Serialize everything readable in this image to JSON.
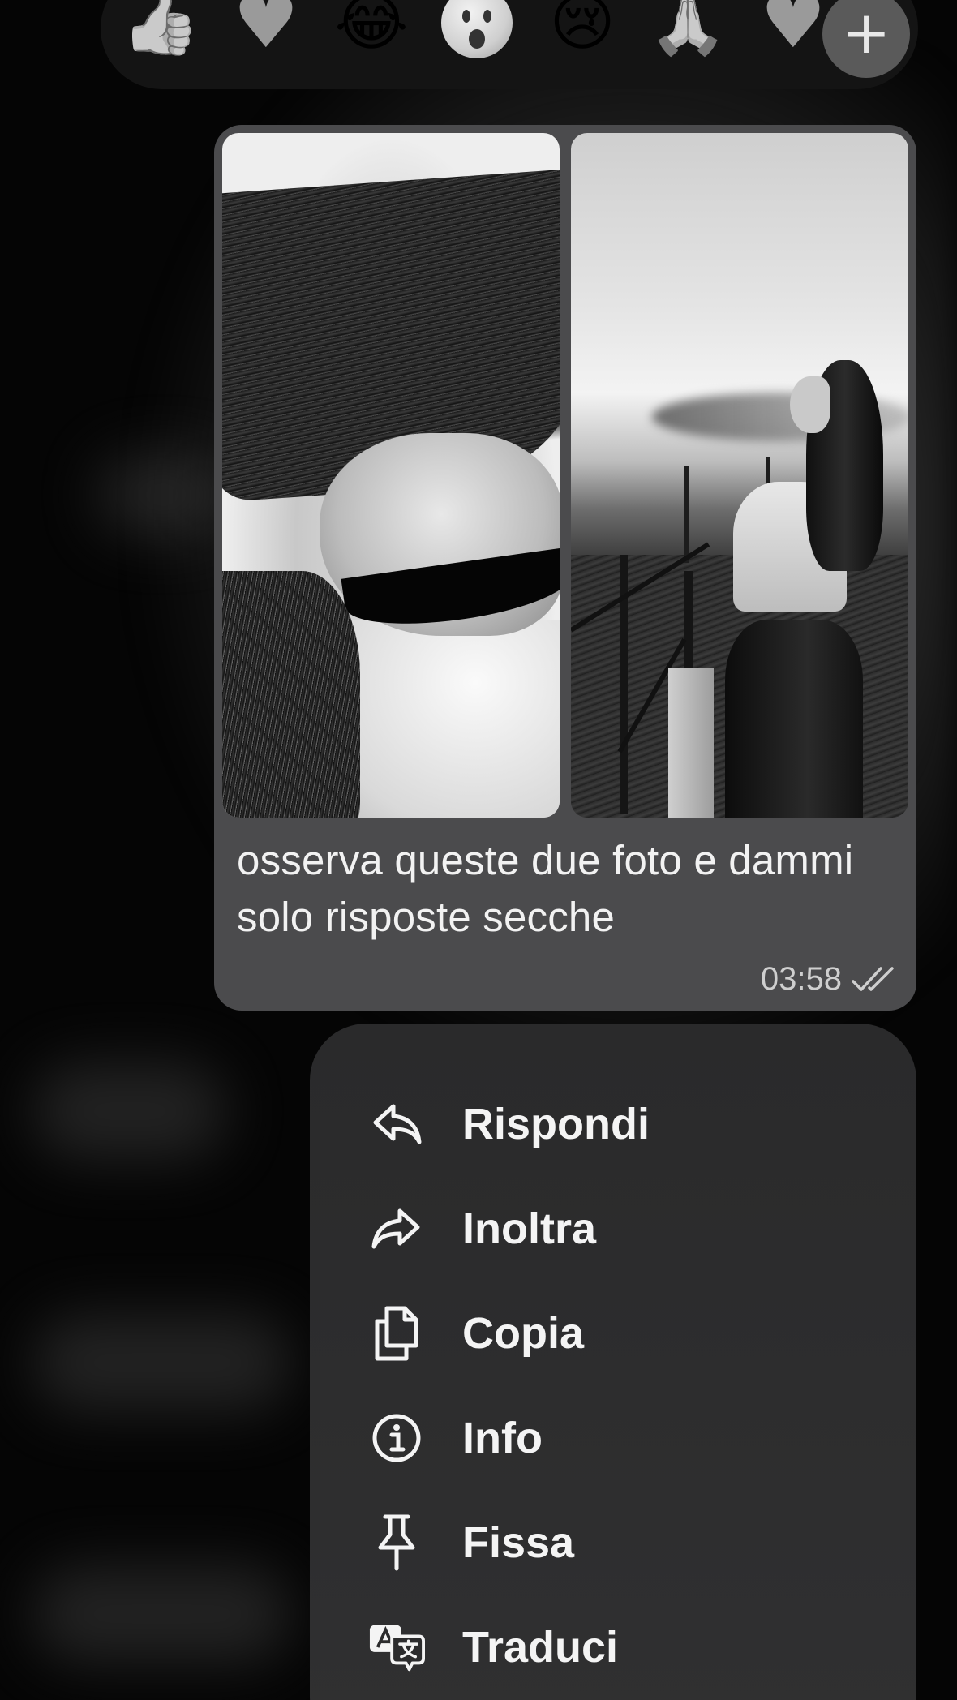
{
  "reactions": {
    "items": [
      {
        "name": "thumbs-up-icon",
        "glyph": "👍"
      },
      {
        "name": "heart-icon",
        "glyph": "♥"
      },
      {
        "name": "laughing-icon",
        "glyph": "😂"
      },
      {
        "name": "surprised-icon",
        "glyph": "😮"
      },
      {
        "name": "crying-icon",
        "glyph": "😢"
      },
      {
        "name": "praying-hands-icon",
        "glyph": "🙏"
      },
      {
        "name": "heart-partial-icon",
        "glyph": "♥"
      }
    ],
    "add_glyph": "+"
  },
  "message": {
    "caption": "osserva queste due foto e dammi solo risposte secche",
    "time": "03:58",
    "status_icon": "double-check-icon"
  },
  "menu": {
    "items": [
      {
        "id": "reply",
        "label": "Rispondi",
        "icon": "reply-icon"
      },
      {
        "id": "forward",
        "label": "Inoltra",
        "icon": "forward-icon"
      },
      {
        "id": "copy",
        "label": "Copia",
        "icon": "copy-icon"
      },
      {
        "id": "info",
        "label": "Info",
        "icon": "info-icon"
      },
      {
        "id": "pin",
        "label": "Fissa",
        "icon": "pin-icon"
      },
      {
        "id": "translate",
        "label": "Traduci",
        "icon": "translate-icon"
      }
    ]
  },
  "colors": {
    "bubble": "#4b4b4d",
    "menu": "#2c2c2d",
    "text": "#f4f4f4"
  }
}
